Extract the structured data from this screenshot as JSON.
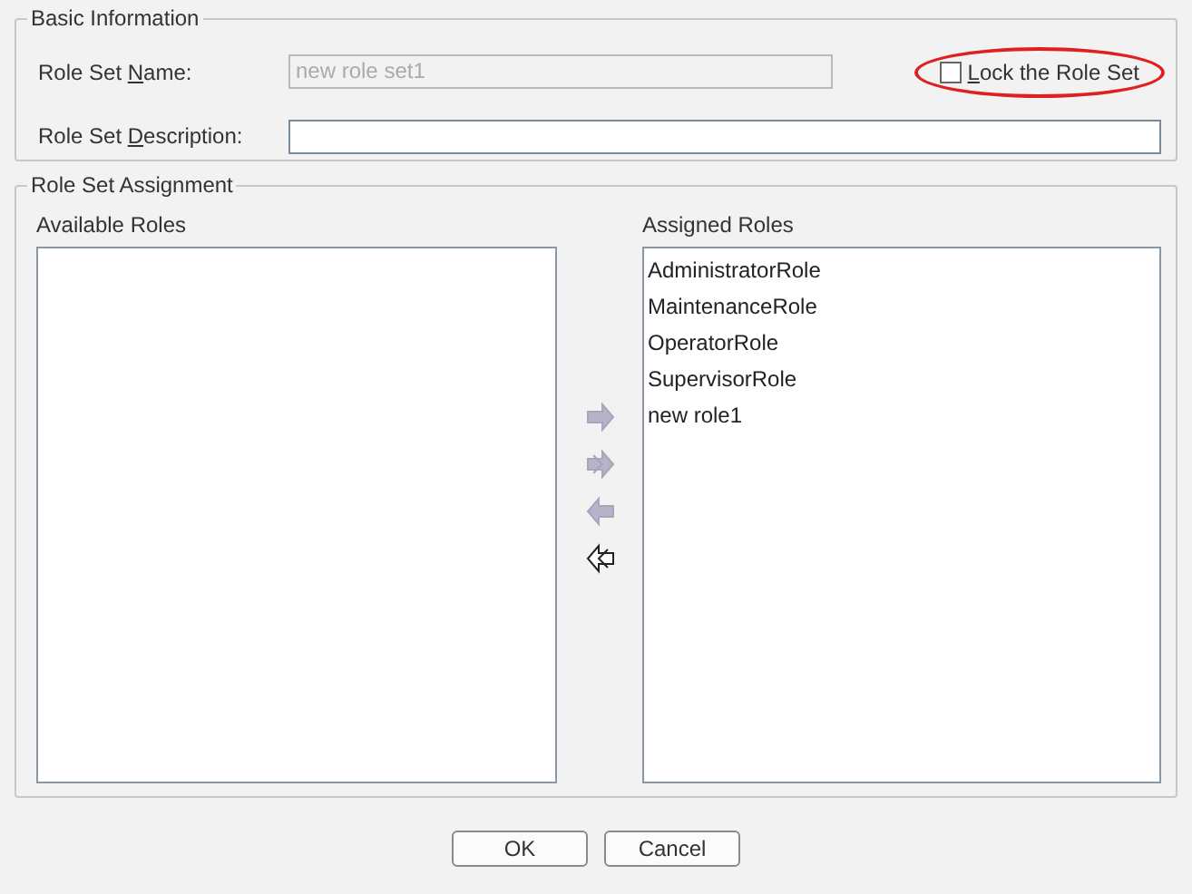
{
  "basic_information": {
    "title": "Basic Information",
    "role_set_name": {
      "label": {
        "before": "Role Set ",
        "key": "N",
        "after": "ame:"
      },
      "value": "new role set1",
      "disabled": true
    },
    "lock_checkbox": {
      "label": {
        "key": "L",
        "after": "ock the Role Set"
      },
      "checked": false,
      "highlighted": true
    },
    "role_set_description": {
      "label": {
        "before": "Role Set ",
        "key": "D",
        "after": "escription:"
      }
    }
  },
  "role_set_assignment": {
    "title": "Role Set Assignment",
    "available_roles": {
      "title": "Available Roles"
    },
    "move_buttons": [
      {
        "kind": "add",
        "disabled": true
      },
      {
        "kind": "add_all",
        "disabled": true
      },
      {
        "kind": "remove",
        "disabled": true
      },
      {
        "kind": "remove_all",
        "disabled": false
      }
    ],
    "assigned_roles": {
      "title": "Assigned Roles",
      "items": [
        "AdministratorRole",
        "MaintenanceRole",
        "OperatorRole",
        "SupervisorRole",
        "new role1"
      ]
    }
  },
  "buttons": [
    "OK",
    "Cancel"
  ]
}
